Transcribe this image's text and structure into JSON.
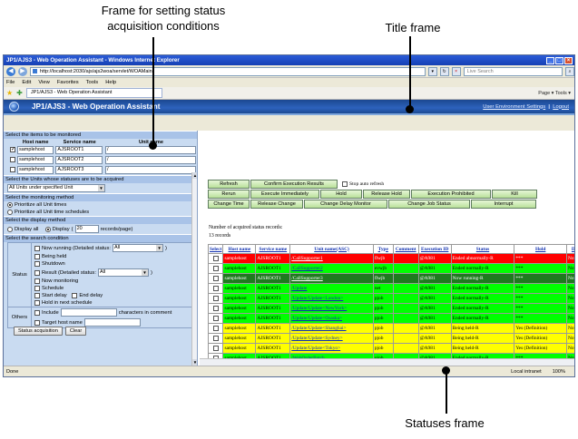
{
  "callouts": {
    "frame_conditions": "Frame for setting status\nacquisition conditions",
    "title_frame": "Title frame",
    "statuses_frame": "Statuses frame"
  },
  "browser": {
    "window_title": "JP1/AJS3 - Web Operation Assistant - Windows Internet Explorer",
    "address": "http://localhost:2030/ajs/ajs2woa/servlet/WOAMain",
    "search_placeholder": "Live Search",
    "menu": [
      "File",
      "Edit",
      "View",
      "Favorites",
      "Tools",
      "Help"
    ],
    "tab_title": "JP1/AJS3 - Web Operation Assistant",
    "tab_tools": "Page ▾   Tools ▾",
    "status_left": "Done",
    "status_zone": "Local intranet",
    "status_zoom": "100%"
  },
  "header": {
    "app_title": "JP1/AJS3 - Web Operation Assistant",
    "user_settings": "User Environment Settings",
    "separator": "|",
    "logout": "Logout"
  },
  "left": {
    "sec_items": "Select the items to be monitored",
    "col_host": "Host name",
    "col_service": "Service name",
    "col_unit": "Unit name",
    "targets": [
      {
        "checked": true,
        "host": "samplehost",
        "service": "AJSROOT1",
        "unit": "/"
      },
      {
        "checked": false,
        "host": "samplehost",
        "service": "AJSROOT2",
        "unit": "/"
      },
      {
        "checked": false,
        "host": "samplehost",
        "service": "AJSROOT3",
        "unit": "/"
      }
    ],
    "sec_units": "Select the Units whose statuses are to be acquired",
    "units_select": "All Units under specified Unit",
    "sec_method": "Select the monitoring method",
    "method_all": "Prioritize all Unit times",
    "method_sched": "Prioritize all Unit time schedules",
    "sec_display": "Select the display method",
    "display_all": "Display all",
    "display_paged": "Display",
    "display_count": "20",
    "display_suffix": "records/page)",
    "display_paren": "(",
    "sec_search": "Select the search condition",
    "status_label": "Status",
    "now_running": "Now running (Detailed status:",
    "now_running_sel": "All",
    "being_held": "Being held",
    "shutdown": "Shutdown",
    "result": "Result (Detailed status:",
    "result_sel": "All",
    "now_monitoring": "Now monitoring",
    "schedule": "Schedule",
    "start_delay": "Start delay",
    "end_delay": "End delay",
    "hold_next": "Hold in next schedule",
    "others_label": "Others",
    "include": "Include",
    "include_suffix": "characters in comment",
    "target_host": "Target host name",
    "btn_acquire": "Status acquisition",
    "btn_clear": "Clear"
  },
  "right": {
    "btn_refresh": "Refresh",
    "btn_confirm": "Confirm Execution Results",
    "stop_auto": "Stop auto refresh",
    "row2": [
      "Rerun",
      "Execute Immediately",
      "Hold",
      "Release Hold",
      "Execution Prohibited",
      "Kill"
    ],
    "row3": [
      "Change Time",
      "Release Change",
      "Change Delay Monitor",
      "Change Job Status",
      "Interrupt"
    ],
    "records_label": "Number of acquired status records:",
    "records_value": "13 records",
    "columns": [
      "Select",
      "Host name",
      "Service name",
      "Unit name(ASC)",
      "Type",
      "Comment",
      "Execution ID",
      "Status",
      "Hold",
      "Delay"
    ],
    "rows": [
      {
        "color": "red",
        "host": "samplehost",
        "service": "AJSROOT1",
        "unit": "/CallSupporter1",
        "type": "flwjb",
        "comment": "",
        "exec": "@A981",
        "status": "Ended abnormally-R",
        "hold": "***",
        "delay": "Not"
      },
      {
        "color": "green",
        "host": "samplehost",
        "service": "AJSROOT1",
        "unit": "/CallSupporter2",
        "type": "evwjb",
        "comment": "",
        "exec": "@A981",
        "status": "Ended normally-R",
        "hold": "***",
        "delay": "Not"
      },
      {
        "color": "dark",
        "host": "samplehost",
        "service": "AJSROOT1",
        "unit": "/CallSupporter3",
        "type": "flwjb",
        "comment": "",
        "exec": "@A981",
        "status": "Now running-R",
        "hold": "***",
        "delay": "Not"
      },
      {
        "color": "green",
        "host": "samplehost",
        "service": "AJSROOT1",
        "unit": "/Update",
        "type": "net",
        "comment": "",
        "exec": "@A981",
        "status": "Ended normally-R",
        "hold": "***",
        "delay": "Not"
      },
      {
        "color": "green",
        "host": "samplehost",
        "service": "AJSROOT1",
        "unit": "/Update/Update<London>",
        "type": "pjob",
        "comment": "",
        "exec": "@A981",
        "status": "Ended normally-R",
        "hold": "***",
        "delay": "Not"
      },
      {
        "color": "green",
        "host": "samplehost",
        "service": "AJSROOT1",
        "unit": "/Update/Update<NewYork>",
        "type": "pjob",
        "comment": "",
        "exec": "@A981",
        "status": "Ended normally-R",
        "hold": "***",
        "delay": "Not"
      },
      {
        "color": "green",
        "host": "samplehost",
        "service": "AJSROOT1",
        "unit": "/Update/Update<Osaska>",
        "type": "pjob",
        "comment": "",
        "exec": "@A981",
        "status": "Ended normally-R",
        "hold": "***",
        "delay": "Not"
      },
      {
        "color": "yellow",
        "host": "samplehost",
        "service": "AJSROOT1",
        "unit": "/Update/Update<Shanghai>",
        "type": "pjob",
        "comment": "",
        "exec": "@A981",
        "status": "Being held-R",
        "hold": "Yes (Definition)",
        "delay": "Not"
      },
      {
        "color": "yellow",
        "host": "samplehost",
        "service": "AJSROOT1",
        "unit": "/Update/Update<Sydney>",
        "type": "pjob",
        "comment": "",
        "exec": "@A981",
        "status": "Being held-R",
        "hold": "Yes (Definition)",
        "delay": "Not"
      },
      {
        "color": "yellow",
        "host": "samplehost",
        "service": "AJSROOT1",
        "unit": "/Update/Update<Tokyo>",
        "type": "pjob",
        "comment": "",
        "exec": "@A981",
        "status": "Being held-R",
        "hold": "Yes (Definition)",
        "delay": "Not"
      },
      {
        "color": "green",
        "host": "samplehost",
        "service": "AJSROOT1",
        "unit": "/WebOrderBatch",
        "type": "qjob",
        "comment": "",
        "exec": "@A981",
        "status": "Ended normally-R",
        "hold": "***",
        "delay": "Not"
      },
      {
        "color": "green",
        "host": "samplehost",
        "service": "AJSROOT1",
        "unit": "/Order",
        "type": "job",
        "comment": "",
        "exec": "@A981",
        "status": "Ended normally-R",
        "hold": "***",
        "delay": "Not"
      },
      {
        "color": "green",
        "host": "samplehost",
        "service": "AJSROOT1",
        "unit": "/OrderData",
        "type": "job",
        "comment": "",
        "exec": "@A981",
        "status": "Ended normally-R",
        "hold": "***",
        "delay": "Not"
      }
    ]
  }
}
